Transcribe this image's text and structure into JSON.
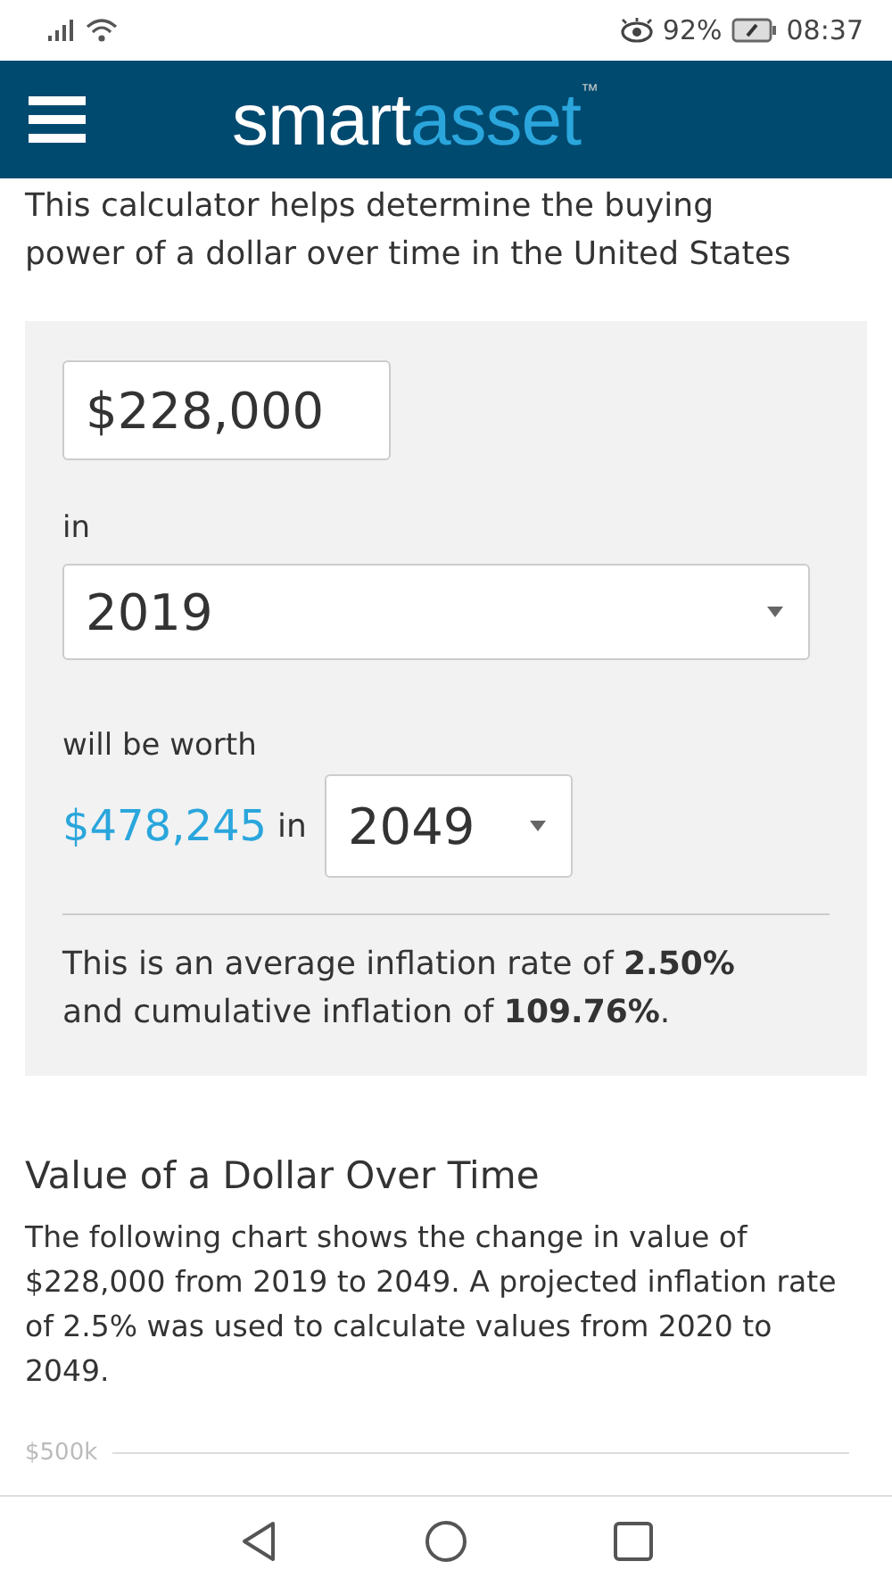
{
  "status_bar": {
    "battery": "92%",
    "time": "08:37"
  },
  "header": {
    "logo_first": "smart",
    "logo_second": "asset",
    "trademark": "™"
  },
  "intro": "This calculator helps determine the buying power of a dollar over time in the United States",
  "calculator": {
    "amount": "$228,000",
    "in_label": "in",
    "start_year": "2019",
    "worth_label": "will be worth",
    "result": "$478,245",
    "in_label_2": "in",
    "end_year": "2049",
    "summary": "This is an average inflation rate of **2.50%** and cumulative inflation of **109.76%**."
  },
  "section": {
    "title": "Value of a Dollar Over Time",
    "text": "The following chart shows the change in value of $228,000 from 2019 to 2049. A projected inflation rate of 2.5% was used to calculate values from 2020 to 2049."
  },
  "chart_axis": {
    "top_label": "$500k"
  }
}
